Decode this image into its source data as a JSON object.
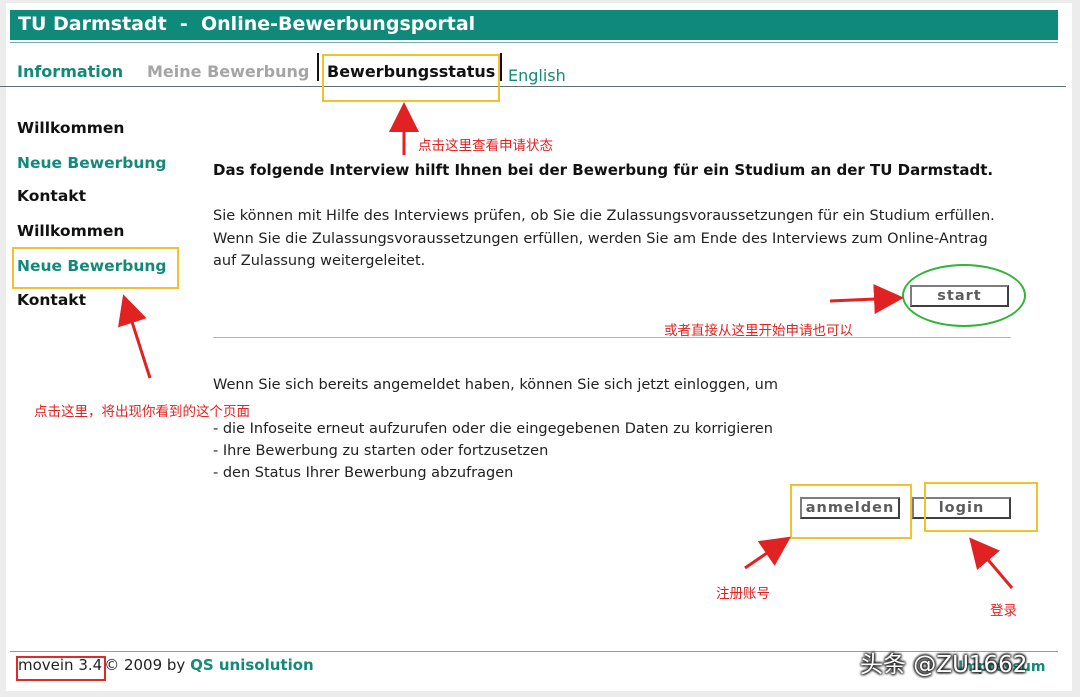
{
  "header": {
    "title": "TU Darmstadt  -  Online-Bewerbungsportal"
  },
  "tabs": {
    "information": "Information",
    "meine_bewerbung": "Meine Bewerbung",
    "bewerbungsstatus": "Bewerbungsstatus",
    "english": "English"
  },
  "sidebar": {
    "items": [
      {
        "label": "Willkommen",
        "style": "dark"
      },
      {
        "label": "Neue Bewerbung",
        "style": "green"
      },
      {
        "label": "Kontakt",
        "style": "dark"
      },
      {
        "label": "Willkommen",
        "style": "dark"
      },
      {
        "label": "Neue Bewerbung",
        "style": "green"
      },
      {
        "label": "Kontakt",
        "style": "dark"
      }
    ]
  },
  "main": {
    "heading": "Das folgende Interview hilft Ihnen bei der Bewerbung für ein Studium an der TU Darmstadt.",
    "intro_lines": [
      "Sie können mit Hilfe des Interviews prüfen, ob Sie die Zulassungsvoraussetzungen für ein Studium erfüllen.",
      "Wenn Sie die Zulassungsvoraussetzungen erfüllen, werden Sie am Ende des Interviews zum Online-Antrag",
      "auf Zulassung weitergeleitet."
    ],
    "start_button": "start",
    "login_intro": "Wenn Sie sich bereits angemeldet haben, können Sie sich jetzt einloggen, um",
    "login_bullets": [
      "- die Infoseite erneut aufzurufen oder die eingegebenen Daten zu korrigieren",
      "- Ihre Bewerbung zu starten oder fortzusetzen",
      "- den Status Ihrer Bewerbung abzufragen"
    ],
    "anmelden_button": "anmelden",
    "login_button": "login"
  },
  "footer": {
    "version": "movein 3.4",
    "copyright": "© 2009 by ",
    "company": "QS unisolution",
    "impressum": "Impressum"
  },
  "annotations": {
    "status_note": "点击这里查看申请状态",
    "start_note": "或者直接从这里开始申请也可以",
    "sidebar_note": "点击这里，将出现你看到的这个页面",
    "register_note": "注册账号",
    "login_note": "登录",
    "watermark": "头条 @ZU1662"
  },
  "colors": {
    "brand_green": "#0f8a7a",
    "link_green": "#138a79",
    "highlight_yellow": "#f2c12e",
    "annotation_red": "#e02222",
    "ellipse_green": "#33b33a"
  }
}
